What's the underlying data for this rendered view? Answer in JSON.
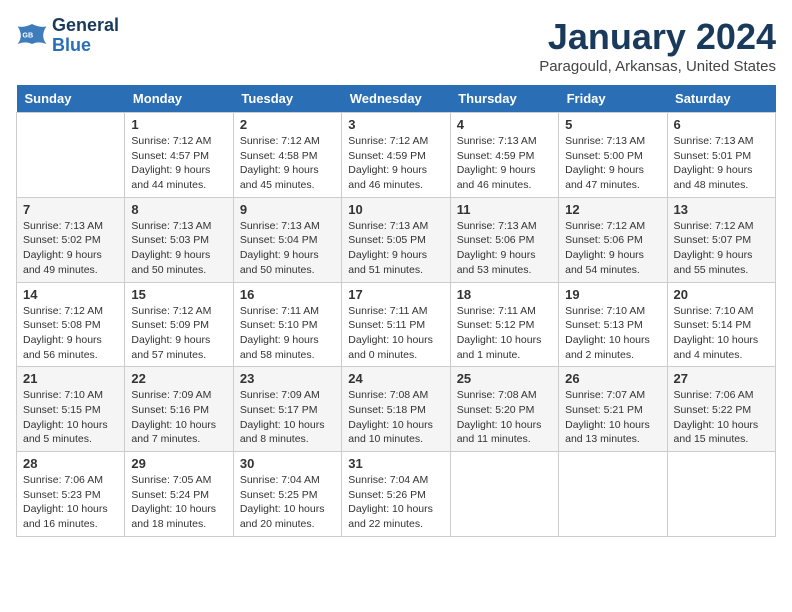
{
  "header": {
    "logo_line1": "General",
    "logo_line2": "Blue",
    "month_title": "January 2024",
    "location": "Paragould, Arkansas, United States"
  },
  "days_of_week": [
    "Sunday",
    "Monday",
    "Tuesday",
    "Wednesday",
    "Thursday",
    "Friday",
    "Saturday"
  ],
  "weeks": [
    [
      {
        "num": "",
        "sunrise": "",
        "sunset": "",
        "daylight": ""
      },
      {
        "num": "1",
        "sunrise": "Sunrise: 7:12 AM",
        "sunset": "Sunset: 4:57 PM",
        "daylight": "Daylight: 9 hours and 44 minutes."
      },
      {
        "num": "2",
        "sunrise": "Sunrise: 7:12 AM",
        "sunset": "Sunset: 4:58 PM",
        "daylight": "Daylight: 9 hours and 45 minutes."
      },
      {
        "num": "3",
        "sunrise": "Sunrise: 7:12 AM",
        "sunset": "Sunset: 4:59 PM",
        "daylight": "Daylight: 9 hours and 46 minutes."
      },
      {
        "num": "4",
        "sunrise": "Sunrise: 7:13 AM",
        "sunset": "Sunset: 4:59 PM",
        "daylight": "Daylight: 9 hours and 46 minutes."
      },
      {
        "num": "5",
        "sunrise": "Sunrise: 7:13 AM",
        "sunset": "Sunset: 5:00 PM",
        "daylight": "Daylight: 9 hours and 47 minutes."
      },
      {
        "num": "6",
        "sunrise": "Sunrise: 7:13 AM",
        "sunset": "Sunset: 5:01 PM",
        "daylight": "Daylight: 9 hours and 48 minutes."
      }
    ],
    [
      {
        "num": "7",
        "sunrise": "Sunrise: 7:13 AM",
        "sunset": "Sunset: 5:02 PM",
        "daylight": "Daylight: 9 hours and 49 minutes."
      },
      {
        "num": "8",
        "sunrise": "Sunrise: 7:13 AM",
        "sunset": "Sunset: 5:03 PM",
        "daylight": "Daylight: 9 hours and 50 minutes."
      },
      {
        "num": "9",
        "sunrise": "Sunrise: 7:13 AM",
        "sunset": "Sunset: 5:04 PM",
        "daylight": "Daylight: 9 hours and 50 minutes."
      },
      {
        "num": "10",
        "sunrise": "Sunrise: 7:13 AM",
        "sunset": "Sunset: 5:05 PM",
        "daylight": "Daylight: 9 hours and 51 minutes."
      },
      {
        "num": "11",
        "sunrise": "Sunrise: 7:13 AM",
        "sunset": "Sunset: 5:06 PM",
        "daylight": "Daylight: 9 hours and 53 minutes."
      },
      {
        "num": "12",
        "sunrise": "Sunrise: 7:12 AM",
        "sunset": "Sunset: 5:06 PM",
        "daylight": "Daylight: 9 hours and 54 minutes."
      },
      {
        "num": "13",
        "sunrise": "Sunrise: 7:12 AM",
        "sunset": "Sunset: 5:07 PM",
        "daylight": "Daylight: 9 hours and 55 minutes."
      }
    ],
    [
      {
        "num": "14",
        "sunrise": "Sunrise: 7:12 AM",
        "sunset": "Sunset: 5:08 PM",
        "daylight": "Daylight: 9 hours and 56 minutes."
      },
      {
        "num": "15",
        "sunrise": "Sunrise: 7:12 AM",
        "sunset": "Sunset: 5:09 PM",
        "daylight": "Daylight: 9 hours and 57 minutes."
      },
      {
        "num": "16",
        "sunrise": "Sunrise: 7:11 AM",
        "sunset": "Sunset: 5:10 PM",
        "daylight": "Daylight: 9 hours and 58 minutes."
      },
      {
        "num": "17",
        "sunrise": "Sunrise: 7:11 AM",
        "sunset": "Sunset: 5:11 PM",
        "daylight": "Daylight: 10 hours and 0 minutes."
      },
      {
        "num": "18",
        "sunrise": "Sunrise: 7:11 AM",
        "sunset": "Sunset: 5:12 PM",
        "daylight": "Daylight: 10 hours and 1 minute."
      },
      {
        "num": "19",
        "sunrise": "Sunrise: 7:10 AM",
        "sunset": "Sunset: 5:13 PM",
        "daylight": "Daylight: 10 hours and 2 minutes."
      },
      {
        "num": "20",
        "sunrise": "Sunrise: 7:10 AM",
        "sunset": "Sunset: 5:14 PM",
        "daylight": "Daylight: 10 hours and 4 minutes."
      }
    ],
    [
      {
        "num": "21",
        "sunrise": "Sunrise: 7:10 AM",
        "sunset": "Sunset: 5:15 PM",
        "daylight": "Daylight: 10 hours and 5 minutes."
      },
      {
        "num": "22",
        "sunrise": "Sunrise: 7:09 AM",
        "sunset": "Sunset: 5:16 PM",
        "daylight": "Daylight: 10 hours and 7 minutes."
      },
      {
        "num": "23",
        "sunrise": "Sunrise: 7:09 AM",
        "sunset": "Sunset: 5:17 PM",
        "daylight": "Daylight: 10 hours and 8 minutes."
      },
      {
        "num": "24",
        "sunrise": "Sunrise: 7:08 AM",
        "sunset": "Sunset: 5:18 PM",
        "daylight": "Daylight: 10 hours and 10 minutes."
      },
      {
        "num": "25",
        "sunrise": "Sunrise: 7:08 AM",
        "sunset": "Sunset: 5:20 PM",
        "daylight": "Daylight: 10 hours and 11 minutes."
      },
      {
        "num": "26",
        "sunrise": "Sunrise: 7:07 AM",
        "sunset": "Sunset: 5:21 PM",
        "daylight": "Daylight: 10 hours and 13 minutes."
      },
      {
        "num": "27",
        "sunrise": "Sunrise: 7:06 AM",
        "sunset": "Sunset: 5:22 PM",
        "daylight": "Daylight: 10 hours and 15 minutes."
      }
    ],
    [
      {
        "num": "28",
        "sunrise": "Sunrise: 7:06 AM",
        "sunset": "Sunset: 5:23 PM",
        "daylight": "Daylight: 10 hours and 16 minutes."
      },
      {
        "num": "29",
        "sunrise": "Sunrise: 7:05 AM",
        "sunset": "Sunset: 5:24 PM",
        "daylight": "Daylight: 10 hours and 18 minutes."
      },
      {
        "num": "30",
        "sunrise": "Sunrise: 7:04 AM",
        "sunset": "Sunset: 5:25 PM",
        "daylight": "Daylight: 10 hours and 20 minutes."
      },
      {
        "num": "31",
        "sunrise": "Sunrise: 7:04 AM",
        "sunset": "Sunset: 5:26 PM",
        "daylight": "Daylight: 10 hours and 22 minutes."
      },
      {
        "num": "",
        "sunrise": "",
        "sunset": "",
        "daylight": ""
      },
      {
        "num": "",
        "sunrise": "",
        "sunset": "",
        "daylight": ""
      },
      {
        "num": "",
        "sunrise": "",
        "sunset": "",
        "daylight": ""
      }
    ]
  ]
}
